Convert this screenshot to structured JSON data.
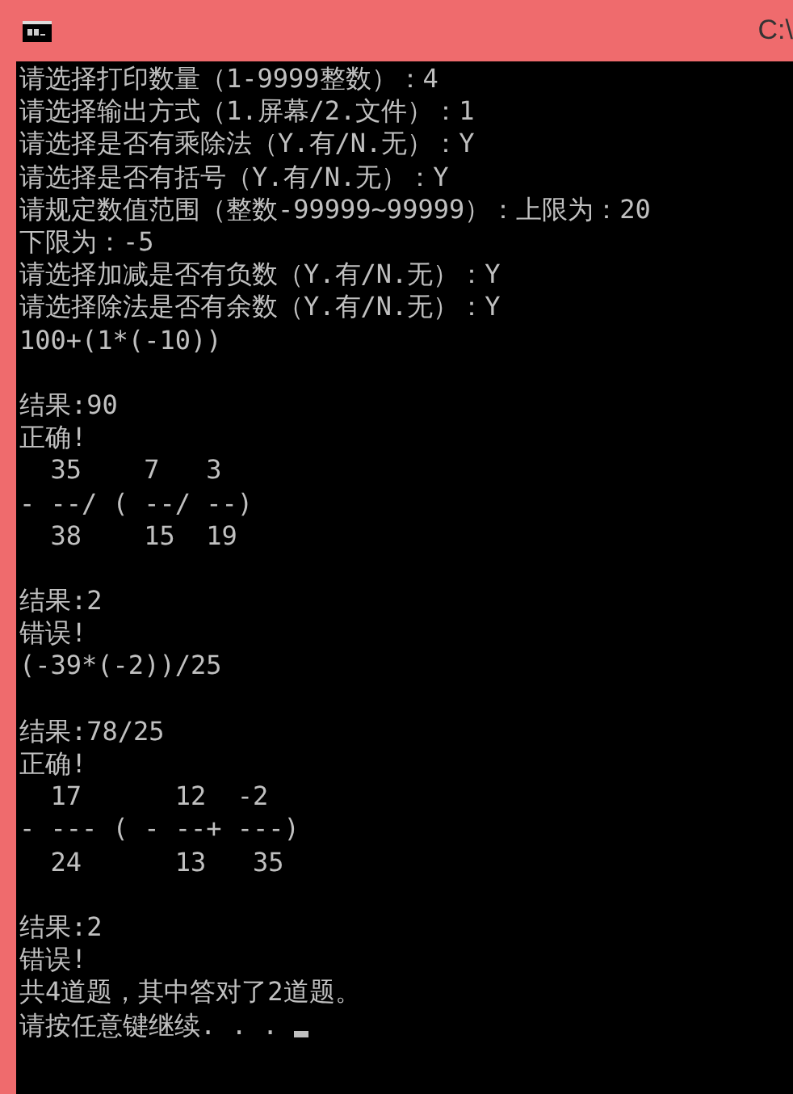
{
  "window": {
    "title": "C:\\"
  },
  "console": {
    "lines": [
      {
        "kind": "text",
        "text": "请选择打印数量（1-9999整数）：4"
      },
      {
        "kind": "text",
        "text": "请选择输出方式（1.屏幕/2.文件）：1"
      },
      {
        "kind": "text",
        "text": "请选择是否有乘除法（Y.有/N.无）：Y"
      },
      {
        "kind": "text",
        "text": "请选择是否有括号（Y.有/N.无）：Y"
      },
      {
        "kind": "text",
        "text": "请规定数值范围（整数-99999~99999）：上限为：20"
      },
      {
        "kind": "text",
        "text": "下限为：-5"
      },
      {
        "kind": "text",
        "text": "请选择加减是否有负数（Y.有/N.无）：Y"
      },
      {
        "kind": "text",
        "text": "请选择除法是否有余数（Y.有/N.无）：Y"
      },
      {
        "kind": "text",
        "text": "100+(1*(-10))"
      },
      {
        "kind": "blank"
      },
      {
        "kind": "text",
        "text": "结果:90"
      },
      {
        "kind": "text",
        "text": "正确!"
      },
      {
        "kind": "text",
        "text": "  35    7   3"
      },
      {
        "kind": "text",
        "text": "- --/ ( --/ --)"
      },
      {
        "kind": "text",
        "text": "  38    15  19"
      },
      {
        "kind": "blank"
      },
      {
        "kind": "text",
        "text": "结果:2"
      },
      {
        "kind": "text",
        "text": "错误!"
      },
      {
        "kind": "text",
        "text": "(-39*(-2))/25"
      },
      {
        "kind": "blank"
      },
      {
        "kind": "text",
        "text": "结果:78/25"
      },
      {
        "kind": "text",
        "text": "正确!"
      },
      {
        "kind": "text",
        "text": "  17      12  -2"
      },
      {
        "kind": "text",
        "text": "- --- ( - --+ ---)"
      },
      {
        "kind": "text",
        "text": "  24      13   35"
      },
      {
        "kind": "blank"
      },
      {
        "kind": "text",
        "text": "结果:2"
      },
      {
        "kind": "text",
        "text": "错误!"
      },
      {
        "kind": "text",
        "text": "共4道题，其中答对了2道题。"
      },
      {
        "kind": "prompt",
        "text": "请按任意键继续. . . "
      }
    ]
  }
}
